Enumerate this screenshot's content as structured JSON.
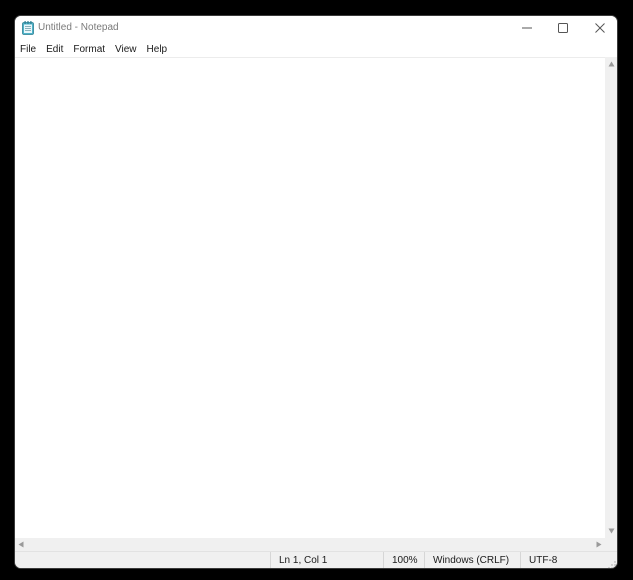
{
  "window": {
    "title": "Untitled - Notepad"
  },
  "icons": {
    "app": "notepad-icon",
    "minimize": "minimize-icon",
    "maximize": "maximize-icon",
    "close": "close-icon"
  },
  "menu": {
    "items": [
      "File",
      "Edit",
      "Format",
      "View",
      "Help"
    ]
  },
  "editor": {
    "content": ""
  },
  "status": {
    "position": "Ln 1, Col 1",
    "zoom": "100%",
    "line_ending": "Windows (CRLF)",
    "encoding": "UTF-8"
  },
  "colors": {
    "background": "#000000",
    "window": "#ffffff",
    "chrome": "#f0f0f0",
    "title_text": "#7a7a7a"
  }
}
